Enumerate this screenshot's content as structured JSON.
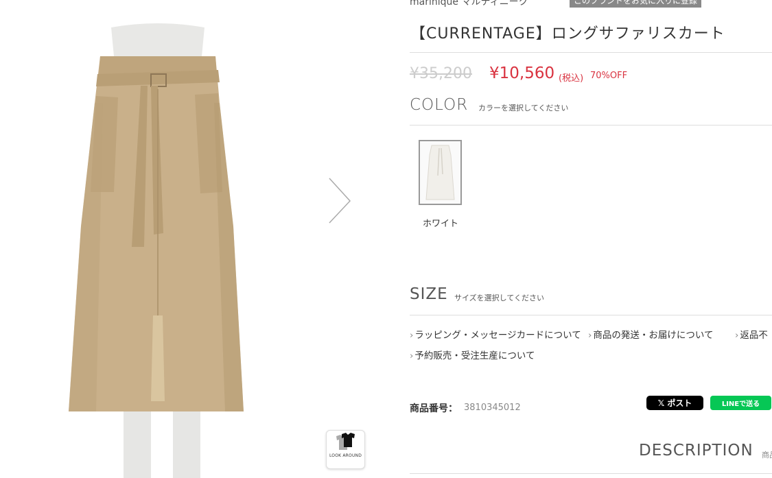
{
  "product": {
    "brand": "marinique マルティニーク",
    "favorite_button": "このブランドをお気に入りに登録",
    "title": "【CURRENTAGE】ロングサファリスカート",
    "price_original": "¥35,200",
    "price_sale": "¥10,560",
    "price_tax": "(税込)",
    "price_discount": "70%OFF",
    "sku_label": "商品番号：",
    "sku_value": "3810345012"
  },
  "color_section": {
    "label": "COLOR",
    "hint": "カラーを選択してください",
    "swatches": [
      {
        "name": "ホワイト"
      }
    ]
  },
  "size_section": {
    "label": "SIZE",
    "hint": "サイズを選択してください"
  },
  "info_links": [
    "ラッピング・メッセージカードについて",
    "商品の発送・お届けについて",
    "返品不",
    "予約販売・受注生産について"
  ],
  "share": {
    "x_label": "𝕏 ポスト",
    "line_label": "LINEで送る"
  },
  "gallery": {
    "look_around_label": "LOOK AROUND"
  },
  "description": {
    "label": "DESCRIPTION",
    "cut_text": "商品"
  },
  "colors": {
    "sale_red": "#d9323f",
    "skirt_beige": "#c9b08a",
    "line_green": "#06c755"
  }
}
